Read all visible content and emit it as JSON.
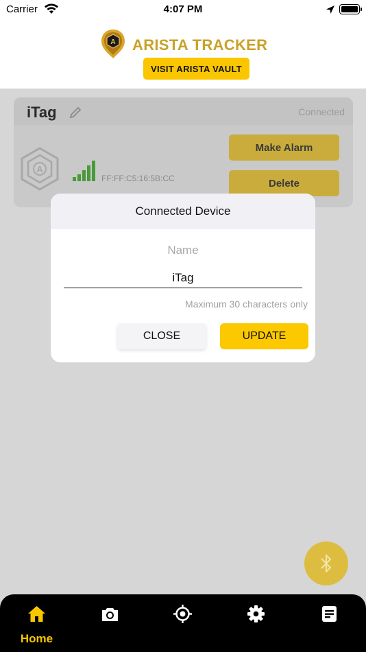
{
  "status_bar": {
    "carrier": "Carrier",
    "time": "4:07 PM"
  },
  "header": {
    "app_title": "ARISTA TRACKER",
    "vault_button": "VISIT ARISTA VAULT"
  },
  "device_card": {
    "name": "iTag",
    "status": "Connected",
    "mac": "FF:FF:C5:16:5B:CC",
    "make_alarm_label": "Make Alarm",
    "delete_label": "Delete"
  },
  "modal": {
    "title": "Connected Device",
    "name_label": "Name",
    "name_value": "iTag",
    "max_note": "Maximum 30 characters only",
    "close_label": "CLOSE",
    "update_label": "UPDATE"
  },
  "bottom_nav": {
    "items": [
      {
        "icon": "home-icon",
        "label": "Home",
        "active": true
      },
      {
        "icon": "camera-icon",
        "label": ""
      },
      {
        "icon": "target-icon",
        "label": ""
      },
      {
        "icon": "gear-icon",
        "label": ""
      },
      {
        "icon": "notes-icon",
        "label": ""
      }
    ]
  },
  "colors": {
    "accent": "#f9c600",
    "gold_text": "#c9a227",
    "signal_green": "#4a9a3a",
    "overlay": "#d6d6d6"
  }
}
